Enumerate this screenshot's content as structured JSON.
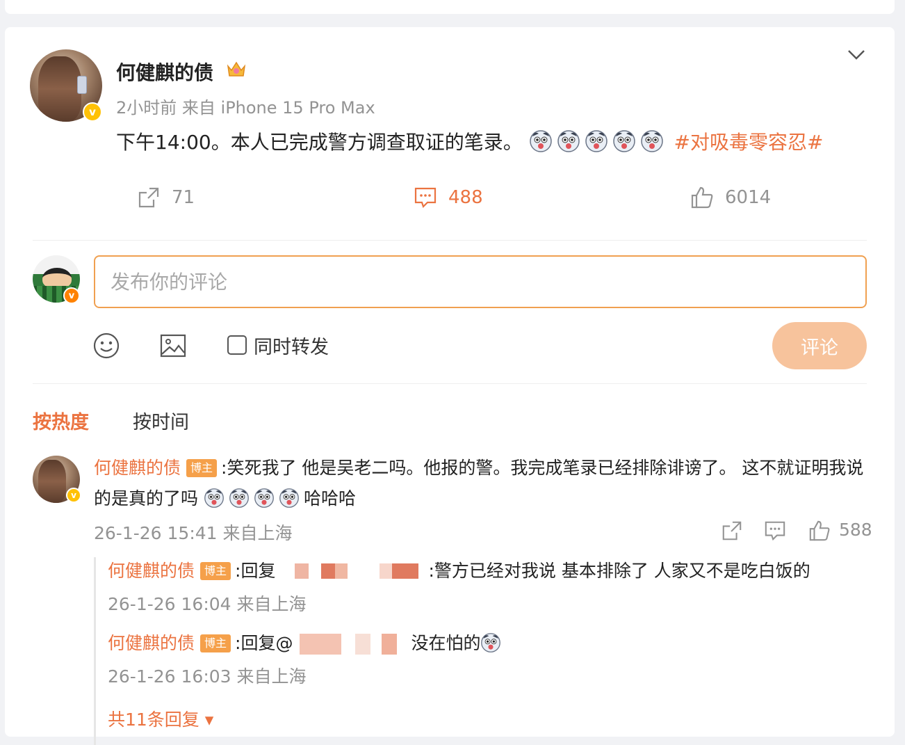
{
  "post": {
    "author": "何健麒的债",
    "meta": "2小时前 来自 iPhone 15 Pro Max",
    "text": "下午14:00。本人已完成警方调查取证的笔录。",
    "hashtag": "#对吸毒零容忍#",
    "emoji_count": 5,
    "repost_count": "71",
    "comment_count": "488",
    "like_count": "6014"
  },
  "composer": {
    "placeholder": "发布你的评论",
    "repost_label": "同时转发",
    "submit_label": "评论"
  },
  "sort": {
    "hot_label": "按热度",
    "time_label": "按时间"
  },
  "comment": {
    "author": "何健麒的债",
    "badge": "博主",
    "text_1": ":笑死我了 他是吴老二吗。他报的警。我完成笔录已经排除诽谤了。 这不就证明我说的是真的了吗 ",
    "text_2": "哈哈哈",
    "meta": "26-1-26 15:41 来自上海",
    "like_count": "588"
  },
  "replies": [
    {
      "author": "何健麒的债",
      "badge": "博主",
      "prefix": ":回复",
      "text": ":警方已经对我说 基本排除了  人家又不是吃白饭的",
      "meta": "26-1-26 16:04 来自上海"
    },
    {
      "author": "何健麒的债",
      "badge": "博主",
      "prefix": ":回复@",
      "text": "没在怕的",
      "meta": "26-1-26 16:03 来自上海"
    }
  ],
  "more_replies_label": "共11条回复",
  "colors": {
    "accent": "#eb7340",
    "muted": "#939393",
    "badge": "#f5a04a"
  }
}
